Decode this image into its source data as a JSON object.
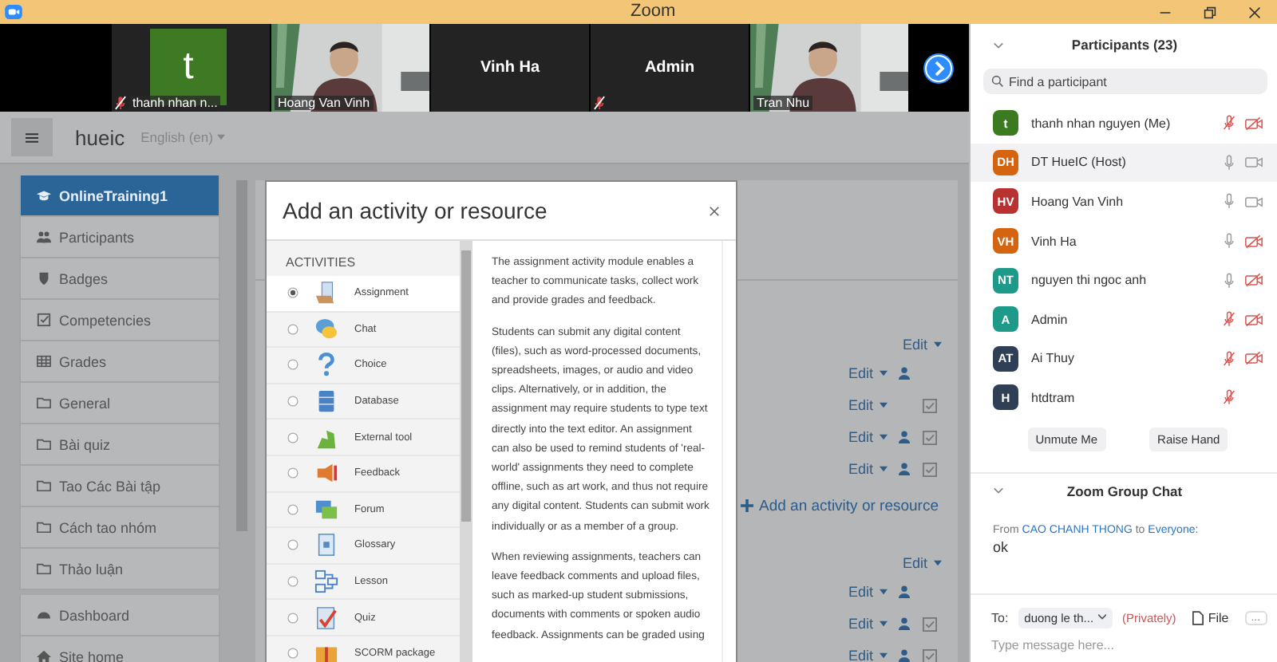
{
  "window": {
    "title": "Zoom"
  },
  "video_strip": {
    "tiles": [
      {
        "kind": "avatar",
        "letter": "t",
        "name": "thanh nhan n...",
        "muted": true
      },
      {
        "kind": "video",
        "name": "Hoang Van Vinh",
        "muted": false
      },
      {
        "kind": "name",
        "display": "Vinh Ha",
        "muted": false
      },
      {
        "kind": "name",
        "display": "Admin",
        "muted": true
      },
      {
        "kind": "video",
        "name": "Tran Nhu",
        "muted": false
      }
    ]
  },
  "moodle": {
    "site": "hueic",
    "language": "English (en)",
    "course_items": [
      {
        "label": "OnlineTraining1",
        "selected": true
      },
      {
        "label": "Participants",
        "selected": false
      },
      {
        "label": "Badges",
        "selected": false
      },
      {
        "label": "Competencies",
        "selected": false
      },
      {
        "label": "Grades",
        "selected": false
      },
      {
        "label": "General",
        "selected": false
      },
      {
        "label": "Bài quiz",
        "selected": false
      },
      {
        "label": "Tao Các Bài tập",
        "selected": false
      },
      {
        "label": "Cách tao nhóm",
        "selected": false
      },
      {
        "label": "Thảo luận",
        "selected": false
      }
    ],
    "site_items": [
      {
        "label": "Dashboard",
        "selected": false
      },
      {
        "label": "Site home",
        "selected": false
      }
    ],
    "course_rows": [
      {
        "kind": "edit-section",
        "label": "Edit"
      },
      {
        "kind": "edit",
        "label": "Edit",
        "user": true,
        "completion": false
      },
      {
        "kind": "edit",
        "label": "Edit",
        "user": false,
        "completion": true
      },
      {
        "kind": "edit",
        "label": "Edit",
        "user": true,
        "completion": true
      },
      {
        "kind": "edit",
        "label": "Edit",
        "user": true,
        "completion": true
      },
      {
        "kind": "add",
        "label": "Add an activity or resource"
      },
      {
        "kind": "edit-section",
        "label": "Edit"
      },
      {
        "kind": "edit",
        "label": "Edit",
        "user": true,
        "completion": false
      },
      {
        "kind": "edit",
        "label": "Edit",
        "user": true,
        "completion": true
      },
      {
        "kind": "edit",
        "label": "Edit",
        "user": true,
        "completion": true
      }
    ],
    "modal": {
      "title": "Add an activity or resource",
      "section": "ACTIVITIES",
      "activities": [
        {
          "label": "Assignment",
          "selected": true
        },
        {
          "label": "Chat",
          "selected": false
        },
        {
          "label": "Choice",
          "selected": false
        },
        {
          "label": "Database",
          "selected": false
        },
        {
          "label": "External tool",
          "selected": false
        },
        {
          "label": "Feedback",
          "selected": false
        },
        {
          "label": "Forum",
          "selected": false
        },
        {
          "label": "Glossary",
          "selected": false
        },
        {
          "label": "Lesson",
          "selected": false
        },
        {
          "label": "Quiz",
          "selected": false
        },
        {
          "label": "SCORM package",
          "selected": false
        }
      ],
      "description": [
        "The assignment activity module enables a teacher to communicate tasks, collect work and provide grades and feedback.",
        "Students can submit any digital content (files), such as word-processed documents, spreadsheets, images, or audio and video clips. Alternatively, or in addition, the assignment may require students to type text directly into the text editor. An assignment can also be used to remind students of 'real-world' assignments they need to complete offline, such as art work, and thus not require any digital content. Students can submit work individually or as a member of a group.",
        "When reviewing assignments, teachers can leave feedback comments and upload files, such as marked-up student submissions, documents with comments or spoken audio feedback. Assignments can be graded using"
      ]
    }
  },
  "participants": {
    "title": "Participants (23)",
    "search": {
      "placeholder": "Find a participant"
    },
    "people": [
      {
        "initials": "t",
        "name": "thanh nhan nguyen (Me)",
        "color": "#3b7a1f",
        "muted": true,
        "video_off": true,
        "highlighted": false
      },
      {
        "initials": "DH",
        "name": "DT HueIC (Host)",
        "color": "#d4640f",
        "muted": false,
        "video_off": false,
        "highlighted": true
      },
      {
        "initials": "HV",
        "name": "Hoang Van Vinh",
        "color": "#b83232",
        "muted": false,
        "video_off": false,
        "highlighted": false
      },
      {
        "initials": "VH",
        "name": "Vinh Ha",
        "color": "#d4640f",
        "muted": false,
        "video_off": true,
        "highlighted": false
      },
      {
        "initials": "NT",
        "name": "nguyen thi ngoc anh",
        "color": "#1e9a8a",
        "muted": false,
        "video_off": true,
        "highlighted": false
      },
      {
        "initials": "A",
        "name": "Admin",
        "color": "#1e9a8a",
        "muted": true,
        "video_off": true,
        "highlighted": false
      },
      {
        "initials": "AT",
        "name": "Ai Thuy",
        "color": "#2f3f55",
        "muted": true,
        "video_off": true,
        "highlighted": false
      },
      {
        "initials": "H",
        "name": "htdtram",
        "color": "#2f3f55",
        "muted": true,
        "highlighted": false
      }
    ],
    "buttons": [
      "Unmute Me",
      "Raise Hand"
    ]
  },
  "chat": {
    "title": "Zoom Group Chat",
    "messages": [
      {
        "from_word": "From",
        "sender": "CAO CHANH THONG",
        "to_word": "to",
        "recipient": "Everyone:",
        "text": "ok"
      }
    ],
    "to_label": "To:",
    "recipient": "duong le th...",
    "privacy": "(Privately)",
    "file_button": "File",
    "more_button": "...",
    "placeholder": "Type message here..."
  }
}
